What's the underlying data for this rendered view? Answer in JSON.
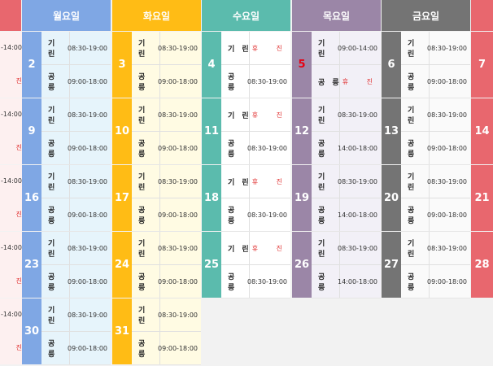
{
  "header": {
    "days": [
      "월요일",
      "화요일",
      "수요일",
      "목요일",
      "금요일"
    ]
  },
  "colors": {
    "sunday": "#e8676e",
    "monday": "#7fa7e4",
    "tuesday": "#ffbc15",
    "wednesday": "#5bbbad",
    "thursday": "#9b86a7",
    "friday": "#747474",
    "saturday": "#e8676e",
    "cell_mon": "#e6f4fb",
    "cell_tue": "#fffbe3",
    "cell_wed": "#ffffff",
    "cell_thu": "#f2f0f7",
    "cell_fri": "#fafafa",
    "closed_text": "#e03030"
  },
  "labels": {
    "kirin": "기 린",
    "gongreung": "공 릉",
    "closed": "휴 진"
  },
  "left_partial": {
    "rows": [
      {
        "top": "-14:00",
        "bottom": "진"
      },
      {
        "top": "-14:00",
        "bottom": "진"
      },
      {
        "top": "-14:00",
        "bottom": "진"
      },
      {
        "top": "-14:00",
        "bottom": "진"
      },
      {
        "top": "-14:00",
        "bottom": "진"
      }
    ]
  },
  "saturday_partial": [
    "7",
    "14",
    "21",
    "28"
  ],
  "weeks": [
    [
      {
        "date": "2",
        "kirin": "08:30-19:00",
        "gongreung": "09:00-18:00"
      },
      {
        "date": "3",
        "kirin": "08:30-19:00",
        "gongreung": "09:00-18:00"
      },
      {
        "date": "4",
        "kirin": "휴 진",
        "gongreung": "08:30-19:00"
      },
      {
        "date": "5",
        "kirin": "09:00-14:00",
        "gongreung": "휴 진"
      },
      {
        "date": "6",
        "kirin": "08:30-19:00",
        "gongreung": "09:00-18:00"
      }
    ],
    [
      {
        "date": "9",
        "kirin": "08:30-19:00",
        "gongreung": "09:00-18:00"
      },
      {
        "date": "10",
        "kirin": "08:30-19:00",
        "gongreung": "09:00-18:00"
      },
      {
        "date": "11",
        "kirin": "휴 진",
        "gongreung": "08:30-19:00"
      },
      {
        "date": "12",
        "kirin": "08:30-19:00",
        "gongreung": "14:00-18:00"
      },
      {
        "date": "13",
        "kirin": "08:30-19:00",
        "gongreung": "09:00-18:00"
      }
    ],
    [
      {
        "date": "16",
        "kirin": "08:30-19:00",
        "gongreung": "09:00-18:00"
      },
      {
        "date": "17",
        "kirin": "08:30-19:00",
        "gongreung": "09:00-18:00"
      },
      {
        "date": "18",
        "kirin": "휴 진",
        "gongreung": "08:30-19:00"
      },
      {
        "date": "19",
        "kirin": "08:30-19:00",
        "gongreung": "14:00-18:00"
      },
      {
        "date": "20",
        "kirin": "08:30-19:00",
        "gongreung": "09:00-18:00"
      }
    ],
    [
      {
        "date": "23",
        "kirin": "08:30-19:00",
        "gongreung": "09:00-18:00"
      },
      {
        "date": "24",
        "kirin": "08:30-19:00",
        "gongreung": "09:00-18:00"
      },
      {
        "date": "25",
        "kirin": "휴 진",
        "gongreung": "08:30-19:00"
      },
      {
        "date": "26",
        "kirin": "08:30-19:00",
        "gongreung": "14:00-18:00"
      },
      {
        "date": "27",
        "kirin": "08:30-19:00",
        "gongreung": "09:00-18:00"
      }
    ],
    [
      {
        "date": "30",
        "kirin": "08:30-19:00",
        "gongreung": "09:00-18:00"
      },
      {
        "date": "31",
        "kirin": "08:30-19:00",
        "gongreung": "09:00-18:00"
      }
    ]
  ]
}
